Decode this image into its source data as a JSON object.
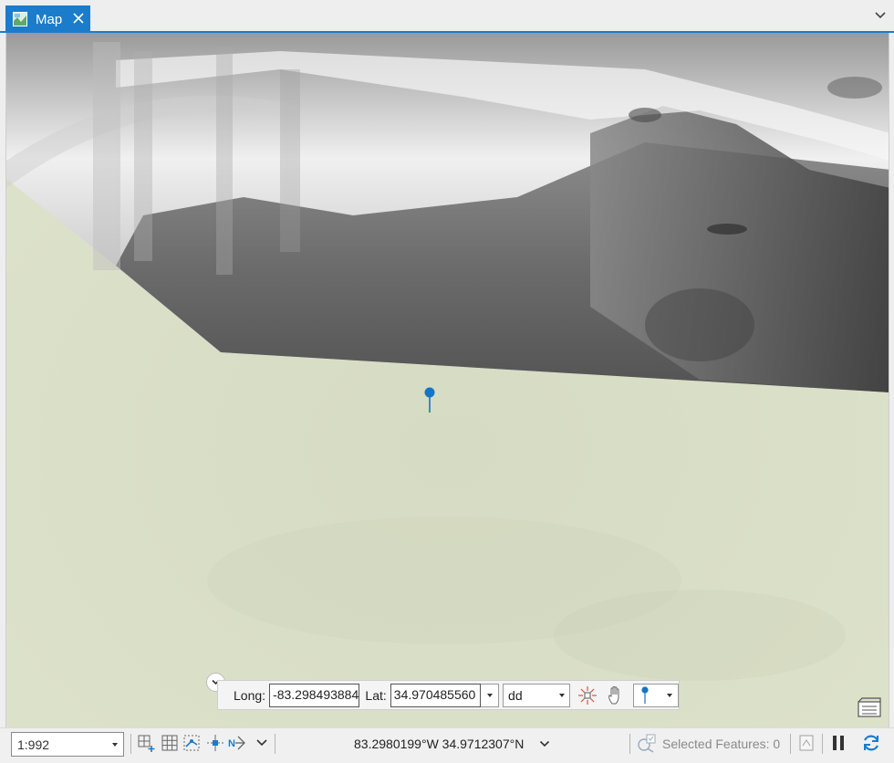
{
  "tab": {
    "label": "Map"
  },
  "coordinates_tool": {
    "long_label": "Long:",
    "long_value": "-83.298493884",
    "lat_label": "Lat:",
    "lat_value": "34.970485560",
    "format_value": "dd"
  },
  "statusbar": {
    "scale_value": "1:992",
    "pointer_coords": "83.2980199°W 34.9712307°N",
    "selected_features": "Selected Features: 0"
  },
  "colors": {
    "accent": "#1b7ccc",
    "terrain_ground": "#d9dec6",
    "pin": "#1475c4"
  }
}
